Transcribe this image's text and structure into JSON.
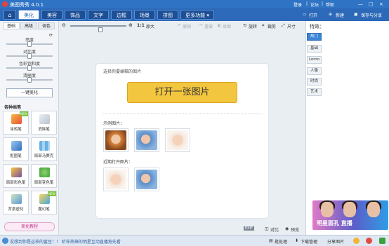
{
  "window": {
    "title": "美图秀秀 4.0.1",
    "login": "登录",
    "links": [
      "|",
      "论坛",
      "|",
      "帮助"
    ],
    "min": "—",
    "max": "□",
    "close": "×"
  },
  "menubar": {
    "tabs": [
      "美化",
      "美容",
      "饰品",
      "文字",
      "边框",
      "场景",
      "拼图",
      "更多功能 ▾"
    ],
    "open": "打开",
    "new": "新建",
    "save": "保存与分享"
  },
  "left": {
    "tabs": [
      "基础",
      "高级",
      "调色"
    ],
    "sliders": [
      {
        "label": "亮度",
        "value": 0.5
      },
      {
        "label": "对比度",
        "value": 0.5
      },
      {
        "label": "色彩饱和度",
        "value": 0.5
      },
      {
        "label": "清晰度",
        "value": 0.5
      }
    ],
    "one_key": "一键美化",
    "pens_title": "各种画笔",
    "pens": [
      {
        "label": "涂鸦笔",
        "tag": "NEW"
      },
      {
        "label": "消除笔"
      },
      {
        "label": "抠图笔"
      },
      {
        "label": "局部马赛克"
      },
      {
        "label": "局部彩色笔"
      },
      {
        "label": "局部变色笔"
      },
      {
        "label": "背景虚化"
      },
      {
        "label": "魔幻笔",
        "tag": "NEW"
      }
    ],
    "tutorial": "美化教程"
  },
  "toolbar": {
    "zoom_ratio": "1:1",
    "original": "原大",
    "undo": "撤销",
    "redo": "重做",
    "compare": "原图",
    "rotate": "旋转",
    "crop": "裁剪",
    "size": "尺寸"
  },
  "panel": {
    "tip": "选择你要编辑的图片",
    "open_button": "打开一张图片",
    "examples_label": "示例图片：",
    "recent_label": "近期打开图片："
  },
  "bottom": {
    "badge": "EXIF",
    "compare": "对比",
    "preview": "预览"
  },
  "right": {
    "title": "特效：",
    "categories": [
      "热门",
      "基础",
      "Lomo",
      "人像",
      "时尚",
      "艺术"
    ],
    "ad_text": "明星面孔 直播"
  },
  "status": {
    "message": "没想到你是这样的蜜豆！！ 听样热辣的明星互动直播抢先看",
    "batch": "批处理",
    "download": "下载管理",
    "share": "分享图片"
  },
  "colors": {
    "title_bar": "#2f73c4",
    "menu_bar": "#2c69b8",
    "open_button": "#f3c63f"
  }
}
